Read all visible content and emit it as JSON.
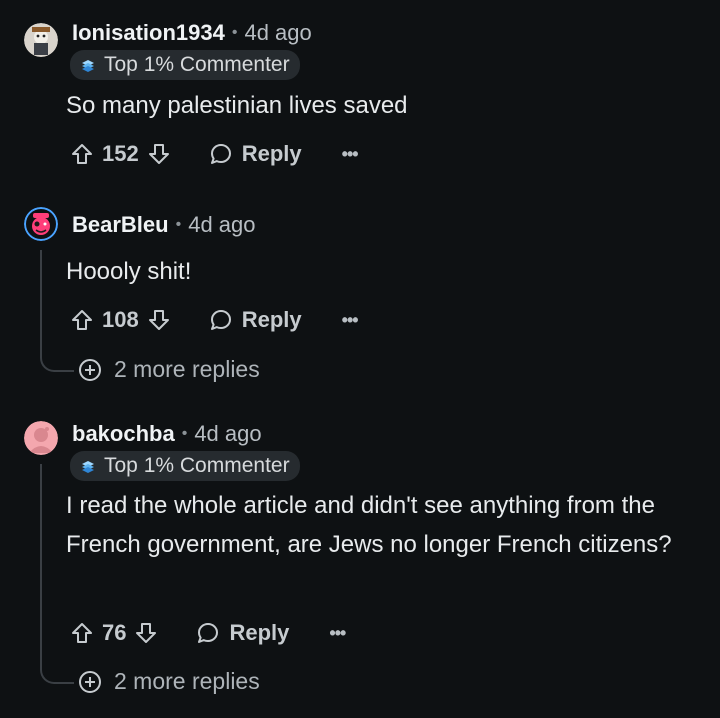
{
  "comments": [
    {
      "author": "Ionisation1934",
      "time": "4d ago",
      "flair": "Top 1% Commenter",
      "text": "So many palestinian lives saved",
      "votes": "152",
      "reply_label": "Reply",
      "more_label": "•••"
    },
    {
      "author": "BearBleu",
      "time": "4d ago",
      "text": "Hoooly shit!",
      "votes": "108",
      "reply_label": "Reply",
      "more_label": "•••",
      "more_replies": "2 more replies"
    },
    {
      "author": "bakochba",
      "time": "4d ago",
      "flair": "Top 1% Commenter",
      "text": "I read the whole article and didn't see anything from the French government, are Jews no longer French citizens?",
      "votes": "76",
      "reply_label": "Reply",
      "more_label": "•••",
      "more_replies": "2 more replies"
    }
  ],
  "separator": "•",
  "colors": {
    "background": "#0e1113",
    "flair_bg": "#262b2f",
    "thread_line": "#3a3f44"
  },
  "icons": [
    "upvote-icon",
    "downvote-icon",
    "comment-bubble-icon",
    "plus-circle-icon",
    "flair-badge-icon"
  ]
}
